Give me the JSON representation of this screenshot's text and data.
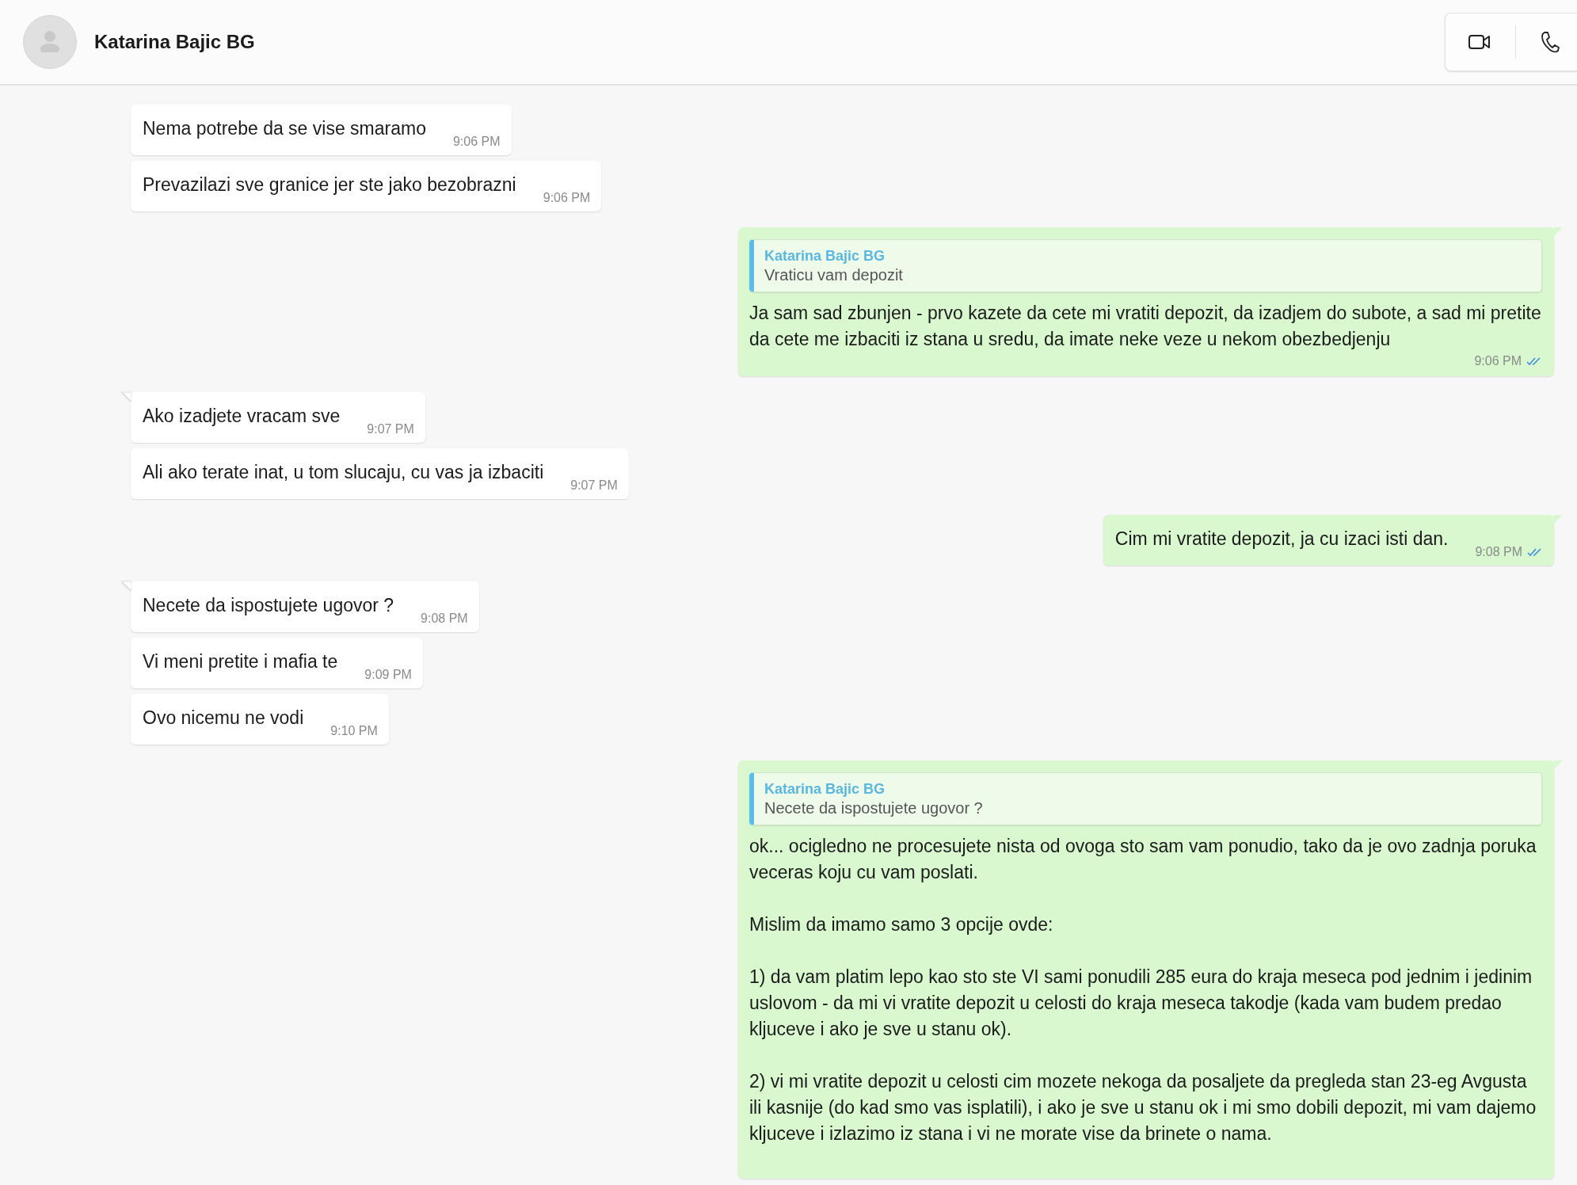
{
  "header": {
    "contact_name": "Katarina Bajic BG"
  },
  "messages": [
    {
      "kind": "incoming",
      "tail": false,
      "text": "Nema potrebe da se vise smaramo",
      "time": "9:06 PM"
    },
    {
      "kind": "incoming",
      "tail": false,
      "text": "Prevazilazi sve granice jer ste jako bezobrazni",
      "time": "9:06 PM"
    },
    {
      "kind": "outgoing",
      "tail": true,
      "reply": {
        "author": "Katarina Bajic BG",
        "text": "Vraticu vam depozit"
      },
      "paragraphs": [
        "Ja sam sad zbunjen - prvo kazete da cete mi vratiti depozit, da izadjem do subote, a sad mi pretite da cete me izbaciti iz stana u sredu, da imate neke veze u nekom obezbedjenju"
      ],
      "time": "9:06 PM",
      "read": true
    },
    {
      "kind": "incoming",
      "tail": true,
      "text": "Ako izadjete vracam sve",
      "time": "9:07 PM"
    },
    {
      "kind": "incoming",
      "tail": false,
      "text": "Ali ako terate inat, u tom slucaju, cu vas ja izbaciti",
      "time": "9:07 PM"
    },
    {
      "kind": "outgoing",
      "tail": true,
      "text": "Cim mi vratite depozit, ja cu izaci isti dan.",
      "time": "9:08 PM",
      "read": true
    },
    {
      "kind": "incoming",
      "tail": true,
      "text": "Necete da ispostujete ugovor ?",
      "time": "9:08 PM"
    },
    {
      "kind": "incoming",
      "tail": false,
      "text": "Vi meni pretite i mafia te",
      "time": "9:09 PM"
    },
    {
      "kind": "incoming",
      "tail": false,
      "text": "Ovo nicemu ne vodi",
      "time": "9:10 PM"
    },
    {
      "kind": "outgoing",
      "tail": true,
      "reply": {
        "author": "Katarina Bajic BG",
        "text": "Necete da ispostujete ugovor ?"
      },
      "paragraphs": [
        "ok... ocigledno ne procesujete nista od ovoga sto sam vam ponudio, tako da je ovo zadnja poruka veceras koju cu vam poslati.",
        "Mislim da imamo samo 3 opcije ovde:",
        "1) da vam platim lepo kao sto ste VI sami ponudili 285 eura do kraja meseca pod jednim i jedinim uslovom - da mi vi vratite depozit u celosti do kraja meseca takodje (kada vam budem predao kljuceve i ako je sve u stanu ok).",
        "2) vi mi vratite depozit u celosti cim mozete nekoga da posaljete da pregleda stan 23-eg Avgusta ili kasnije (do kad smo vas isplatili), i ako je sve u stanu ok i mi smo dobili depozit, mi vam dajemo kljuceve i izlazimo iz stana i vi ne morate vise da brinete o nama."
      ]
    }
  ]
}
